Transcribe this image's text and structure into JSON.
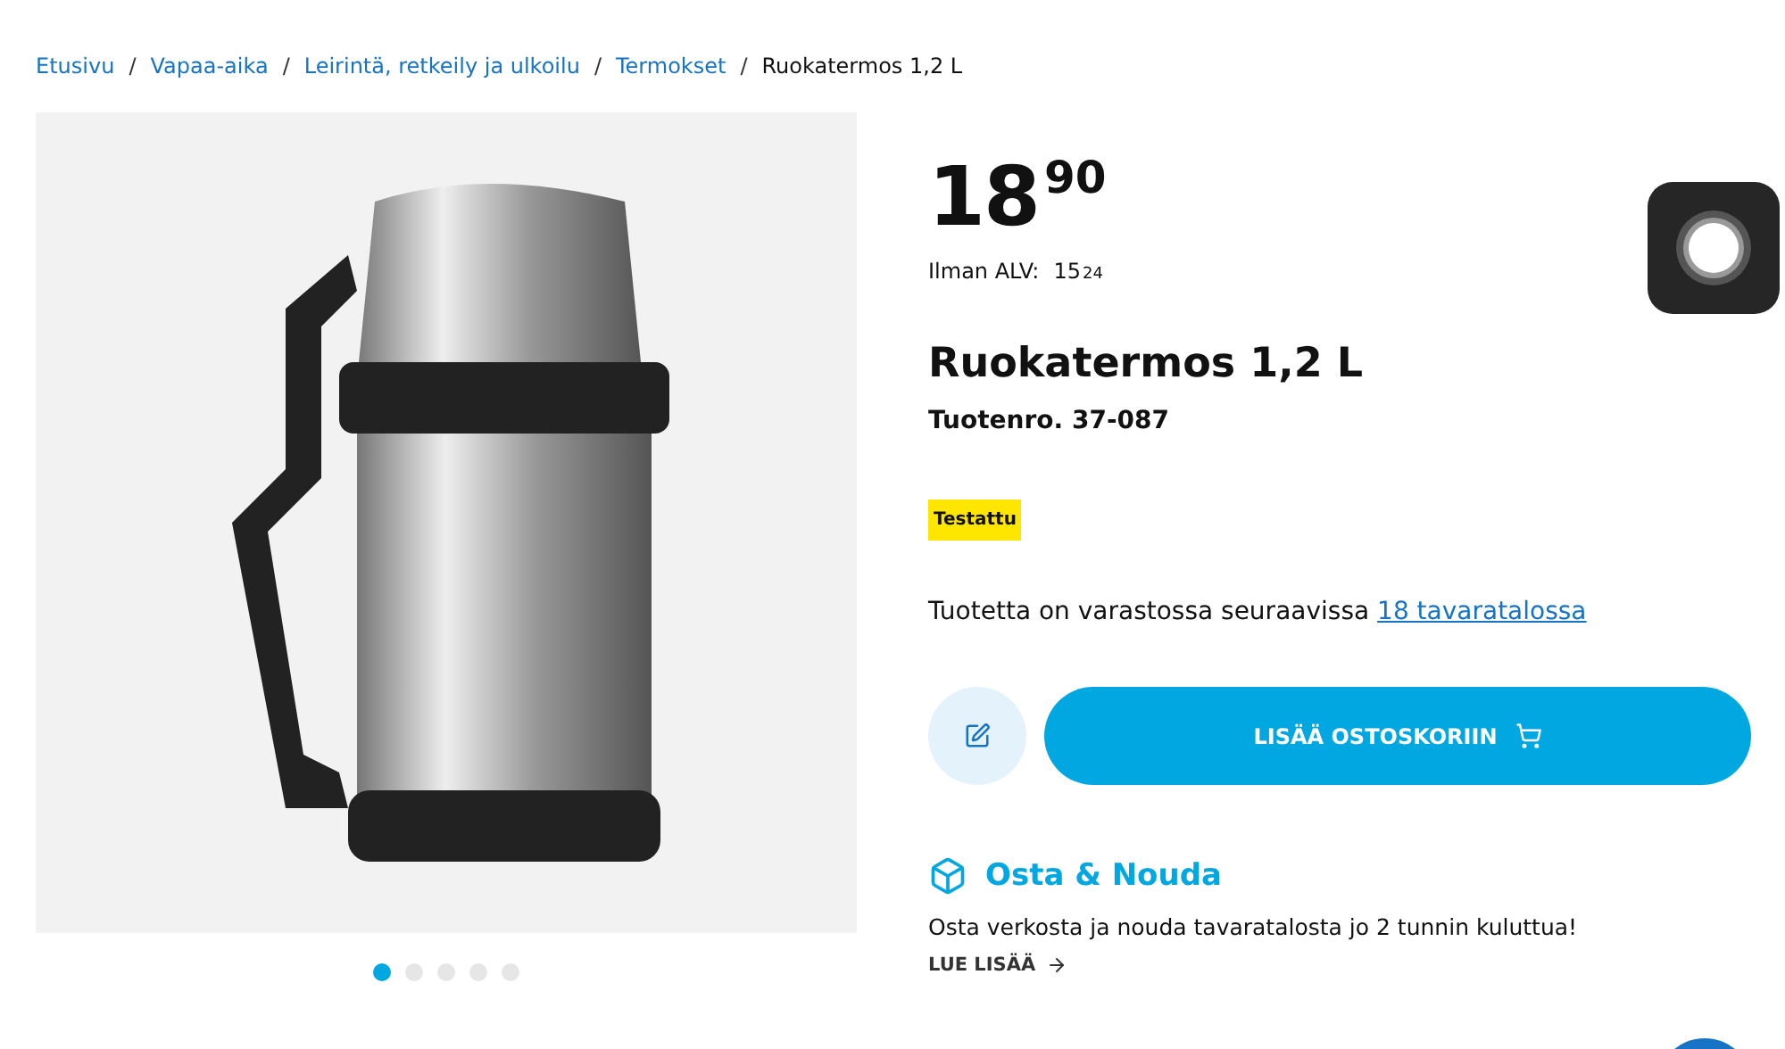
{
  "breadcrumb": [
    {
      "label": "Etusivu",
      "link": true,
      "separator": "/"
    },
    {
      "label": "Vapaa-aika",
      "link": true,
      "separator": "/"
    },
    {
      "label": "Leirintä, retkeily ja ulkoilu",
      "link": true,
      "separator": "/"
    },
    {
      "label": "Termokset",
      "link": true,
      "separator": "/"
    },
    {
      "label": "Ruokatermos 1,2 L",
      "link": false
    }
  ],
  "gallery": {
    "dots": [
      {
        "selected": true
      },
      {
        "selected": false
      },
      {
        "selected": false
      },
      {
        "selected": false
      },
      {
        "selected": false
      }
    ]
  },
  "price": {
    "main": "18",
    "cents": "90"
  },
  "net_price": {
    "label": "Ilman ALV:",
    "main": "15",
    "cents": "24"
  },
  "product": {
    "title": "Ruokatermos 1,2 L",
    "number": "Tuotenro. 37-087",
    "badge": "Testattu"
  },
  "stock": {
    "text": "Tuotetta on varastossa seuraavissa",
    "link": "18 tavaratalossa"
  },
  "add_to_cart": {
    "label": "LISÄÄ OSTOSKORIIN"
  },
  "pickup": {
    "title": "Osta & Nouda",
    "text": "Osta verkosta ja nouda tavaratalosta jo 2 tunnin kuluttua!",
    "link": "LUE LISÄÄ"
  }
}
